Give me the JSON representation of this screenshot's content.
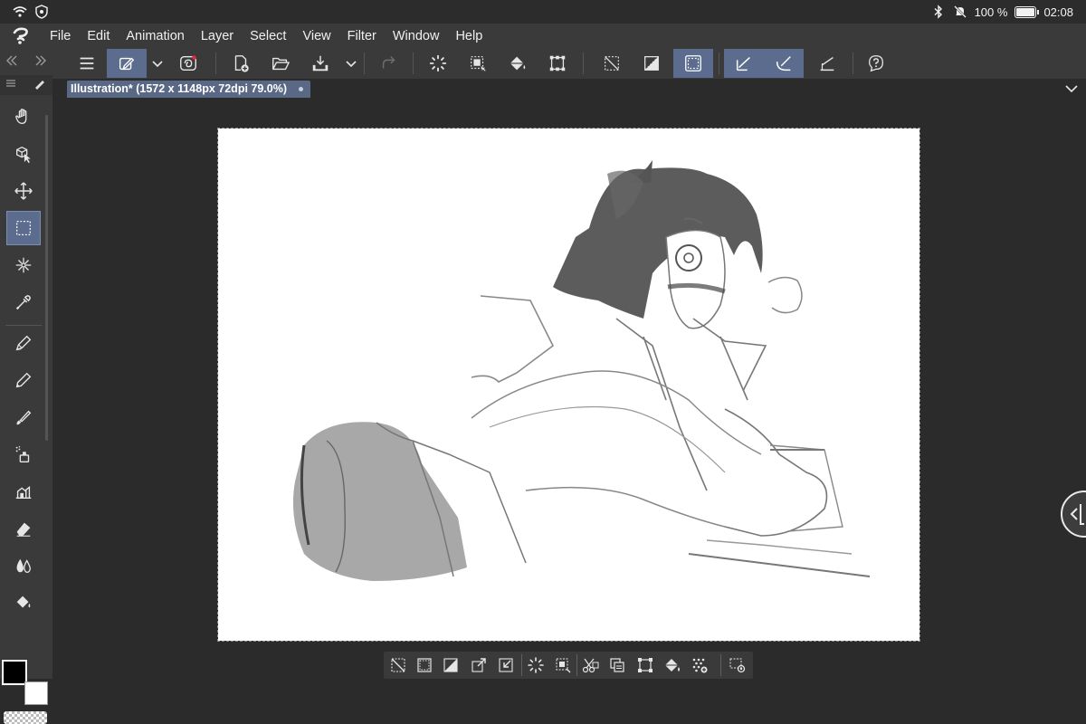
{
  "status_bar": {
    "battery_text": "100 %",
    "time": "02:08",
    "icons": [
      "wifi-icon",
      "shield-icon",
      "bluetooth-icon",
      "mute-bell-icon",
      "battery-icon"
    ]
  },
  "menu": {
    "logo": "clip-studio-logo-icon",
    "items": [
      "File",
      "Edit",
      "Animation",
      "Layer",
      "Select",
      "View",
      "Filter",
      "Window",
      "Help"
    ]
  },
  "tools": [
    {
      "name": "hand-icon",
      "active": false
    },
    {
      "name": "operation-icon",
      "active": false
    },
    {
      "name": "move-layer-icon",
      "active": false
    },
    {
      "name": "selection-icon",
      "active": true
    },
    {
      "name": "auto-select-icon",
      "active": false
    },
    {
      "name": "eyedropper-icon",
      "active": false
    },
    {
      "name": "pen-icon",
      "active": false
    },
    {
      "name": "pencil-icon",
      "active": false
    },
    {
      "name": "brush-icon",
      "active": false
    },
    {
      "name": "airbrush-icon",
      "active": false
    },
    {
      "name": "decoration-icon",
      "active": false
    },
    {
      "name": "eraser-icon",
      "active": false
    },
    {
      "name": "blend-icon",
      "active": false
    },
    {
      "name": "fill-icon",
      "active": false
    }
  ],
  "command_bar": {
    "buttons": [
      {
        "name": "menu-icon",
        "active": false
      },
      {
        "name": "edit-shortcut-icon",
        "active": true
      },
      {
        "name": "companion-mode-icon",
        "active": false
      },
      {
        "name": "new-file-icon",
        "active": false
      },
      {
        "name": "open-icon",
        "active": false
      },
      {
        "name": "save-icon",
        "active": false
      },
      {
        "name": "redo-icon",
        "active": false
      },
      {
        "name": "select-all-icon",
        "active": false
      },
      {
        "name": "deselect-icon",
        "active": false
      },
      {
        "name": "fill-bucket-icon",
        "active": false
      },
      {
        "name": "transform-icon",
        "active": false
      },
      {
        "name": "clear-selection-icon",
        "active": false
      },
      {
        "name": "invert-selection-icon",
        "active": false
      },
      {
        "name": "show-selection-icon",
        "active": true
      },
      {
        "name": "snap-ruler-icon",
        "active": true
      },
      {
        "name": "snap-special-ruler-icon",
        "active": true
      },
      {
        "name": "snap-grid-icon",
        "active": false
      },
      {
        "name": "help-icon",
        "active": false
      }
    ]
  },
  "document": {
    "tab_title": "Illustration* (1572 x 1148px 72dpi 79.0%)"
  },
  "colors": {
    "foreground": "#000000",
    "background": "#ffffff",
    "accent": "#5b6c8e"
  },
  "selection_launcher": {
    "buttons": [
      "clear-selection-icon",
      "deselect-icon",
      "invert-selection-icon",
      "expand-selection-icon",
      "shrink-selection-icon",
      "convert-to-selection-icon",
      "selection-stamp-icon",
      "cut-paste-icon",
      "copy-paste-icon",
      "scale-rotate-icon",
      "fill-selection-icon",
      "new-tone-icon",
      "launcher-settings-icon"
    ]
  }
}
